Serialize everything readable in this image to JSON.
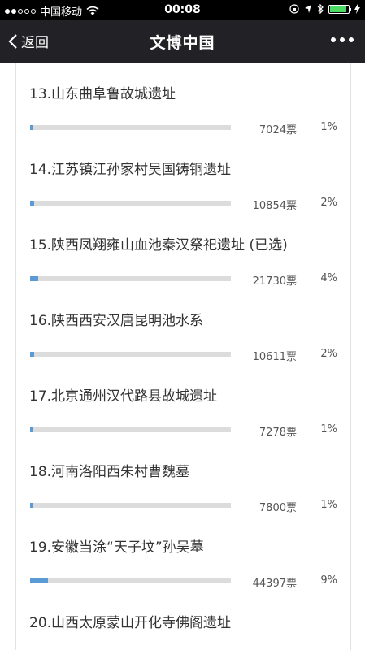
{
  "status": {
    "carrier": "中国移动",
    "time": "00:08"
  },
  "nav": {
    "back_label": "返回",
    "title": "文博中国"
  },
  "vote_items": [
    {
      "title": "13.山东曲阜鲁故城遗址",
      "votes": "7024票",
      "percent": "1%",
      "ratio": 0.01
    },
    {
      "title": "14.江苏镇江孙家村吴国铸铜遗址",
      "votes": "10854票",
      "percent": "2%",
      "ratio": 0.02
    },
    {
      "title": "15.陕西凤翔雍山血池秦汉祭祀遗址 (已选)",
      "votes": "21730票",
      "percent": "4%",
      "ratio": 0.04
    },
    {
      "title": "16.陕西西安汉唐昆明池水系",
      "votes": "10611票",
      "percent": "2%",
      "ratio": 0.02
    },
    {
      "title": "17.北京通州汉代路县故城遗址",
      "votes": "7278票",
      "percent": "1%",
      "ratio": 0.01
    },
    {
      "title": "18.河南洛阳西朱村曹魏墓",
      "votes": "7800票",
      "percent": "1%",
      "ratio": 0.01
    },
    {
      "title": "19.安徽当涂“天子坟”孙吴墓",
      "votes": "44397票",
      "percent": "9%",
      "ratio": 0.09
    },
    {
      "title": "20.山西太原蒙山开化寺佛阁遗址",
      "votes": "",
      "percent": "",
      "ratio": 0
    }
  ],
  "colors": {
    "bar_fill": "#5b9bd5",
    "bar_track": "#dcdcdc",
    "nav_bg": "#222226"
  }
}
